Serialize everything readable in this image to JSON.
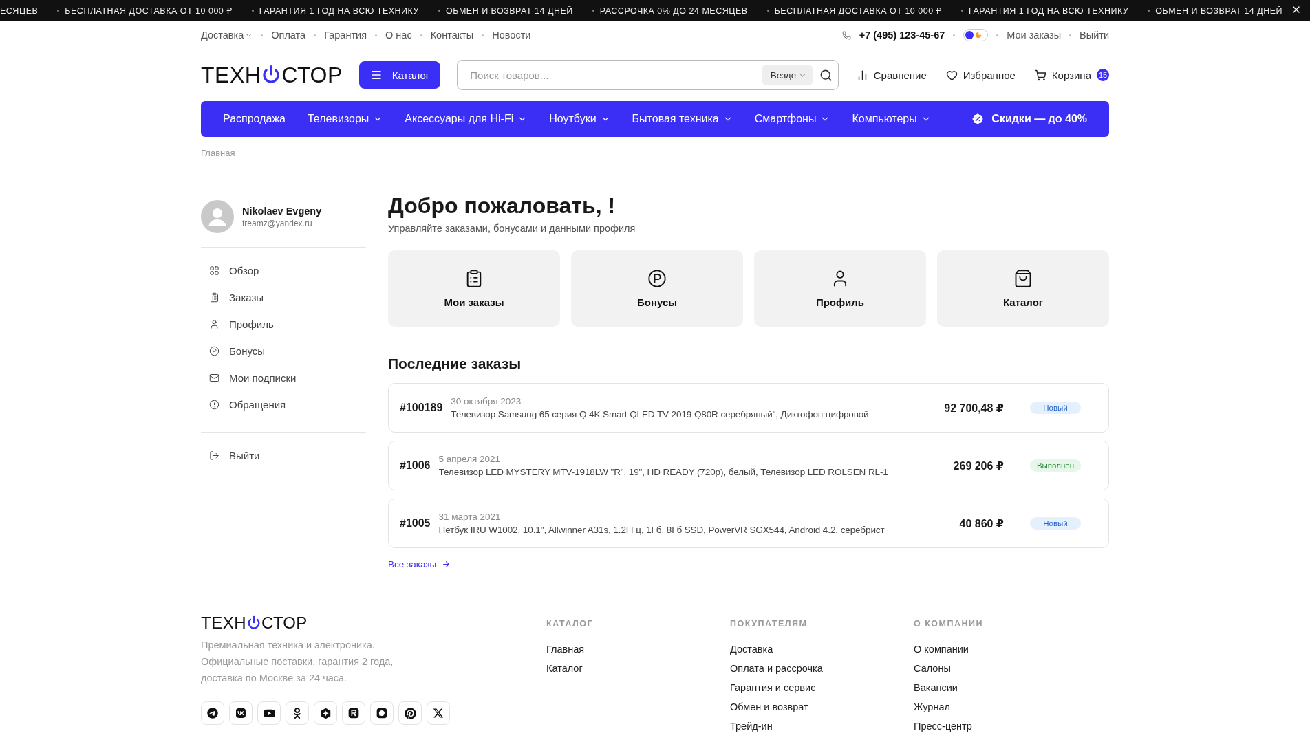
{
  "ticker": {
    "items": [
      "ЕСЯЦЕВ",
      "БЕСПЛАТНАЯ ДОСТАВКА ОТ 10 000 ₽",
      "ГАРАНТИЯ 1 ГОД НА ВСЮ ТЕХНИКУ",
      "ОБМЕН И ВОЗВРАТ 14 ДНЕЙ",
      "РАССРОЧКА 0% ДО 24 МЕСЯЦЕВ",
      "БЕСПЛАТНАЯ ДОСТАВКА ОТ 10 000 ₽",
      "ГАРАНТИЯ 1 ГОД НА ВСЮ ТЕХНИКУ",
      "ОБМЕН И ВОЗВРАТ 14 ДНЕЙ"
    ]
  },
  "top_links": [
    {
      "label": "Доставка",
      "dropdown": true
    },
    {
      "label": "Оплата",
      "dropdown": false
    },
    {
      "label": "Гарантия",
      "dropdown": false
    },
    {
      "label": "О нас",
      "dropdown": false
    },
    {
      "label": "Контакты",
      "dropdown": false
    },
    {
      "label": "Новости",
      "dropdown": false
    }
  ],
  "top_right": {
    "phone": "+7 (495) 123-45-67",
    "theme_toggle": {
      "on": false
    },
    "links": [
      "Мои заказы",
      "Выйти"
    ]
  },
  "header": {
    "logo": {
      "left": "ТЕХН",
      "right": "СТОР"
    },
    "catalog_button": "Каталог",
    "search": {
      "placeholder": "Поиск товаров...",
      "scope": "Везде"
    },
    "actions": [
      {
        "kind": "compare",
        "label": "Сравнение"
      },
      {
        "kind": "favorites",
        "label": "Избранное"
      },
      {
        "kind": "cart",
        "label": "Корзина",
        "badge": "15"
      }
    ]
  },
  "nav": {
    "items": [
      {
        "label": "Распродажа",
        "dropdown": false
      },
      {
        "label": "Телевизоры",
        "dropdown": true
      },
      {
        "label": "Аксессуары для Hi-Fi",
        "dropdown": true
      },
      {
        "label": "Ноутбуки",
        "dropdown": true
      },
      {
        "label": "Бытовая техника",
        "dropdown": true
      },
      {
        "label": "Смартфоны",
        "dropdown": true
      },
      {
        "label": "Компьютеры",
        "dropdown": true
      }
    ],
    "promo": "Скидки — до 40%"
  },
  "breadcrumb": "Главная",
  "sidebar": {
    "user": {
      "name": "Nikolaev Evgeny",
      "email": "treamz@yandex.ru"
    },
    "items": [
      {
        "kind": "overview",
        "label": "Обзор"
      },
      {
        "kind": "orders",
        "label": "Заказы"
      },
      {
        "kind": "profile",
        "label": "Профиль"
      },
      {
        "kind": "bonus",
        "label": "Бонусы"
      },
      {
        "kind": "mail",
        "label": "Мои подписки"
      },
      {
        "kind": "alert",
        "label": "Обращения"
      }
    ],
    "logout": "Выйти"
  },
  "welcome": {
    "title": "Добро пожаловать, !",
    "subtitle": "Управляйте заказами, бонусами и данными профиля",
    "tiles": [
      {
        "kind": "orders",
        "label": "Мои заказы"
      },
      {
        "kind": "bonus",
        "label": "Бонусы"
      },
      {
        "kind": "profile",
        "label": "Профиль"
      },
      {
        "kind": "catalog",
        "label": "Каталог"
      }
    ]
  },
  "recent_orders": {
    "title": "Последние заказы",
    "orders": [
      {
        "number": "#100189",
        "date": "30 октября 2023",
        "items": "Телевизор Samsung 65 серия Q 4K Smart QLED TV 2019 Q80R серебряный\", Диктофон цифровой",
        "total": "92 700,48 ₽",
        "status": "Новый",
        "kind": "new"
      },
      {
        "number": "#1006",
        "date": "5 апреля 2021",
        "items": "Телевизор LED MYSTERY MTV-1918LW \"R\", 19\", HD READY (720p), белый, Телевизор LED ROLSEN RL-1",
        "total": "269 206 ₽",
        "status": "Выполнен",
        "kind": "done"
      },
      {
        "number": "#1005",
        "date": "31 марта 2021",
        "items": "Нетбук IRU W1002, 10.1\", Allwinner A31s, 1.2ГГц, 1Гб, 8Гб SSD, PowerVR SGX544, Android 4.2, серебрист",
        "total": "40 860 ₽",
        "status": "Новый",
        "kind": "new"
      }
    ],
    "all_link": "Все заказы"
  },
  "footer": {
    "logo": {
      "left": "ТЕХН",
      "right": "СТОР"
    },
    "tagline": "Премиальная техника и электроника. Официальные поставки, гарантия 2 года, доставка по Москве за 24 часа.",
    "socials": [
      {
        "kind": "telegram"
      },
      {
        "kind": "vk"
      },
      {
        "kind": "youtube"
      },
      {
        "kind": "ok"
      },
      {
        "kind": "star"
      },
      {
        "kind": "rutube"
      },
      {
        "kind": "chat"
      },
      {
        "kind": "pinterest"
      },
      {
        "kind": "x"
      }
    ],
    "columns": [
      {
        "title": "КАТАЛОГ",
        "links": [
          "Главная",
          "Каталог"
        ]
      },
      {
        "title": "ПОКУПАТЕЛЯМ",
        "links": [
          "Доставка",
          "Оплата и рассрочка",
          "Гарантия и сервис",
          "Обмен и возврат",
          "Трейд-ин"
        ]
      },
      {
        "title": "О КОМПАНИИ",
        "links": [
          "О компании",
          "Салоны",
          "Вакансии",
          "Журнал",
          "Пресс-центр"
        ]
      }
    ]
  }
}
